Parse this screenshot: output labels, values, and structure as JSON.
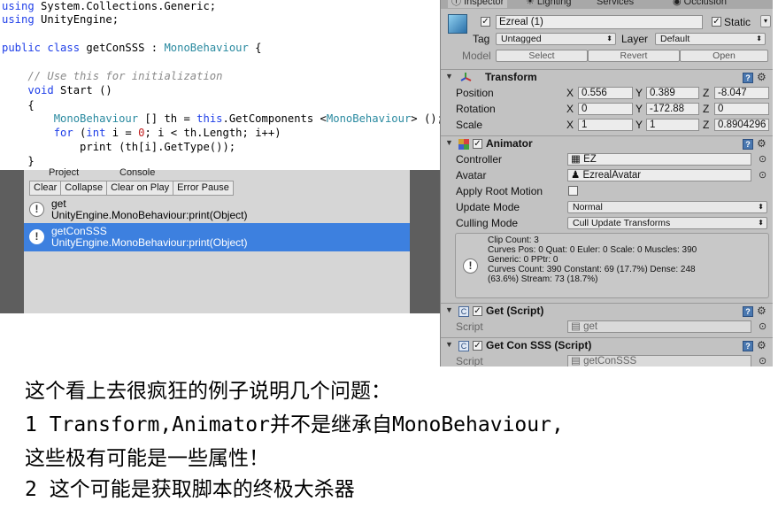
{
  "code": {
    "lines": [
      [
        {
          "t": "using",
          "c": "kw"
        },
        {
          "t": " System.Collections.Generic;"
        }
      ],
      [
        {
          "t": "using",
          "c": "kw"
        },
        {
          "t": " UnityEngine;"
        }
      ],
      [],
      [
        {
          "t": "public class",
          "c": "kw"
        },
        {
          "t": " getConSSS : "
        },
        {
          "t": "MonoBehaviour",
          "c": "ty"
        },
        {
          "t": " {"
        }
      ],
      [],
      [
        {
          "t": "    "
        },
        {
          "t": "// Use this for initialization",
          "c": "cm"
        }
      ],
      [
        {
          "t": "    "
        },
        {
          "t": "void",
          "c": "kw"
        },
        {
          "t": " Start ()"
        }
      ],
      [
        {
          "t": "    {"
        }
      ],
      [
        {
          "t": "        "
        },
        {
          "t": "MonoBehaviour",
          "c": "ty"
        },
        {
          "t": " [] th = "
        },
        {
          "t": "this",
          "c": "kw"
        },
        {
          "t": ".GetComponents <"
        },
        {
          "t": "MonoBehaviour",
          "c": "ty"
        },
        {
          "t": "> ();"
        }
      ],
      [
        {
          "t": "        "
        },
        {
          "t": "for",
          "c": "kw"
        },
        {
          "t": " ("
        },
        {
          "t": "int",
          "c": "kw"
        },
        {
          "t": " i = "
        },
        {
          "t": "0",
          "c": "nm"
        },
        {
          "t": "; i < th.Length; i++)"
        }
      ],
      [
        {
          "t": "            print (th[i].GetType());"
        }
      ],
      [
        {
          "t": "    }"
        }
      ]
    ]
  },
  "console": {
    "tabs": [
      "Project",
      "Console"
    ],
    "toolbar": [
      "Clear",
      "Collapse",
      "Clear on Play",
      "Error Pause"
    ],
    "entries": [
      {
        "line1": "get",
        "line2": "UnityEngine.MonoBehaviour:print(Object)",
        "selected": false
      },
      {
        "line1": "getConSSS",
        "line2": "UnityEngine.MonoBehaviour:print(Object)",
        "selected": true
      }
    ]
  },
  "inspector": {
    "tabs": [
      "Inspector",
      "Lighting",
      "Services",
      "Occlusion"
    ],
    "object_name": "Ezreal (1)",
    "static_label": "Static",
    "tag_label": "Tag",
    "tag_value": "Untagged",
    "layer_label": "Layer",
    "layer_value": "Default",
    "model_label": "Model",
    "model_buttons": [
      "Select",
      "Revert",
      "Open"
    ],
    "transform": {
      "title": "Transform",
      "rows": [
        {
          "label": "Position",
          "x": "0.556",
          "y": "0.389",
          "z": "-8.047"
        },
        {
          "label": "Rotation",
          "x": "0",
          "y": "-172.88",
          "z": "0"
        },
        {
          "label": "Scale",
          "x": "1",
          "y": "1",
          "z": "0.8904296"
        }
      ]
    },
    "animator": {
      "title": "Animator",
      "controller_label": "Controller",
      "controller_value": "EZ",
      "avatar_label": "Avatar",
      "avatar_value": "EzrealAvatar",
      "apply_root_motion_label": "Apply Root Motion",
      "update_mode_label": "Update Mode",
      "update_mode_value": "Normal",
      "culling_mode_label": "Culling Mode",
      "culling_mode_value": "Cull Update Transforms",
      "info_lines": [
        "Clip Count: 3",
        "Curves Pos: 0 Quat: 0 Euler: 0 Scale: 0 Muscles: 390",
        "Generic: 0 PPtr: 0",
        "Curves Count: 390 Constant: 69 (17.7%) Dense: 248",
        "(63.6%) Stream: 73 (18.7%)"
      ]
    },
    "get_script": {
      "title": "Get (Script)",
      "script_label": "Script",
      "script_value": "get"
    },
    "getconsss_script": {
      "title": "Get Con SSS (Script)",
      "script_label": "Script",
      "script_value": "getConSSS"
    }
  },
  "caption": {
    "lines": [
      "这个看上去很疯狂的例子说明几个问题：",
      "1 Transform,Animator并不是继承自MonoBehaviour,",
      "这些极有可能是一些属性！",
      "2 这个可能是获取脚本的终极大杀器"
    ]
  },
  "colors": {
    "selection": "#3d80df",
    "inspector_bg": "#c2c2c2",
    "keyword": "#1e3ee8",
    "type": "#2a8aa0",
    "comment": "#8a8a8a"
  }
}
